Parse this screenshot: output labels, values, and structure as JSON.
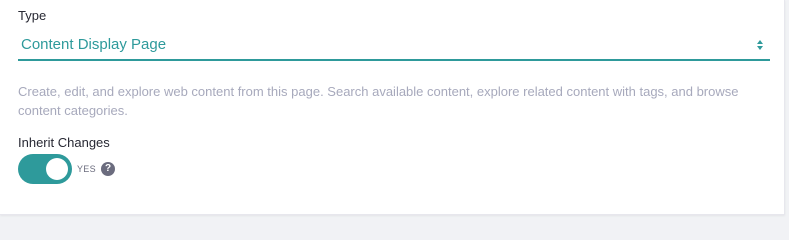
{
  "type_field": {
    "label": "Type",
    "selected_value": "Content Display Page",
    "arrows_icon": "sort-arrows-icon",
    "accent_color": "#2e9a9b"
  },
  "description": "Create, edit, and explore web content from this page. Search available content, explore related content with tags, and browse content categories.",
  "inherit_changes": {
    "label": "Inherit Changes",
    "state": true,
    "state_label": "YES",
    "help_icon": "question-mark-icon",
    "help_glyph": "?"
  }
}
